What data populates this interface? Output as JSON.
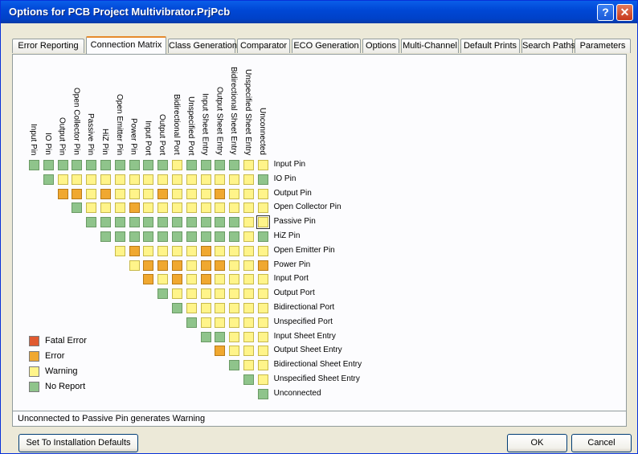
{
  "window": {
    "title": "Options for PCB Project Multivibrator.PrjPcb",
    "help_glyph": "?",
    "close_glyph": "✕"
  },
  "tabs": [
    "Error Reporting",
    "Connection Matrix",
    "Class Generation",
    "Comparator",
    "ECO Generation",
    "Options",
    "Multi-Channel",
    "Default Prints",
    "Search Paths",
    "Parameters"
  ],
  "active_tab": "Connection Matrix",
  "matrix": {
    "pins": [
      "Input Pin",
      "IO Pin",
      "Output Pin",
      "Open Collector Pin",
      "Passive Pin",
      "HiZ Pin",
      "Open Emitter Pin",
      "Power Pin",
      "Input Port",
      "Output Port",
      "Bidirectional Port",
      "Unspecified Port",
      "Input Sheet Entry",
      "Output Sheet Entry",
      "Bidirectional Sheet Entry",
      "Unspecified Sheet Entry",
      "Unconnected"
    ],
    "rows": [
      "ggggggggggyggggyy",
      "gyyyyyyyyyyyyyyg",
      "ooyoyyyoyyyoyyy",
      "gyyyoyyyyyyyyy",
      "gggggggggggyy",
      "ggggggggggyg",
      "yoyyyyoyyyy",
      "yoooyooyyo",
      "oyoyoyyyy",
      "gyyyyyyy",
      "gyyyyyy",
      "gyyyyy",
      "ggyyy",
      "oyyy",
      "gyy",
      "gy",
      "g"
    ],
    "selected": {
      "row": 4,
      "col": 16
    },
    "color_map": {
      "g": "#8fc48b",
      "y": "#fff48a",
      "o": "#f0a830",
      "r": "#e05a30"
    }
  },
  "legend": [
    {
      "label": "Fatal Error",
      "color": "#e05a30"
    },
    {
      "label": "Error",
      "color": "#f0a830"
    },
    {
      "label": "Warning",
      "color": "#fff48a"
    },
    {
      "label": "No Report",
      "color": "#8fc48b"
    }
  ],
  "status_text": "Unconnected to Passive Pin generates Warning",
  "buttons": {
    "defaults": "Set To Installation Defaults",
    "ok": "OK",
    "cancel": "Cancel"
  }
}
